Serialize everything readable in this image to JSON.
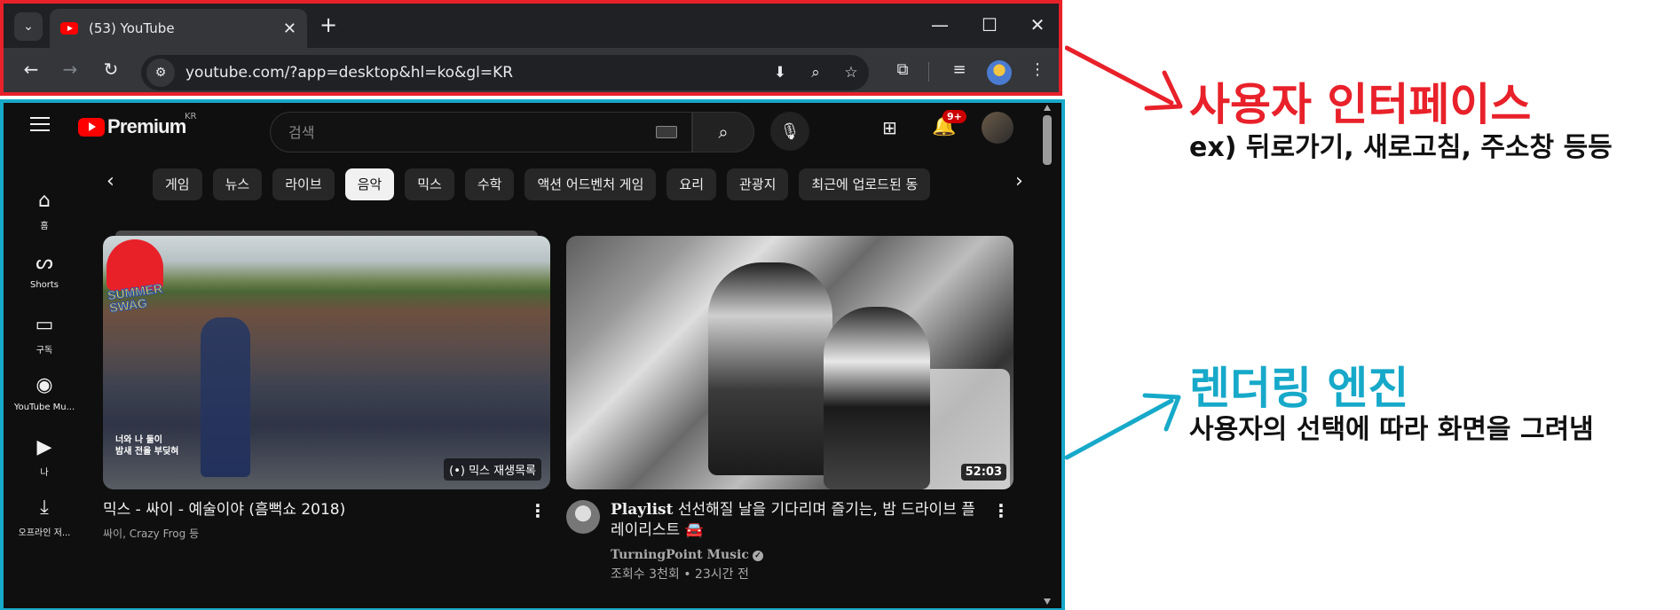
{
  "browser": {
    "tab_title": "(53) YouTube",
    "url": "youtube.com/?app=desktop&hl=ko&gl=KR",
    "accent_color": "#e8212a"
  },
  "youtube": {
    "brand": "Premium",
    "country": "KR",
    "search_placeholder": "검색",
    "notification_count": "9+",
    "sidebar": [
      {
        "label": "홈",
        "icon": "home-icon"
      },
      {
        "label": "Shorts",
        "icon": "shorts-icon"
      },
      {
        "label": "구독",
        "icon": "subscriptions-icon"
      },
      {
        "label": "YouTube Mu...",
        "icon": "youtube-music-icon"
      },
      {
        "label": "나",
        "icon": "you-icon"
      },
      {
        "label": "오프라인 저...",
        "icon": "download-icon"
      }
    ],
    "chips": [
      "게임",
      "뉴스",
      "라이브",
      "음악",
      "믹스",
      "수학",
      "액션 어드벤처 게임",
      "요리",
      "관광지",
      "최근에 업로드된 동"
    ],
    "active_chip": "음악",
    "videos": [
      {
        "title": "믹스 - 싸이 - 예술이야 (흠뻑쇼 2018)",
        "subtitle": "싸이, Crazy Frog 등",
        "overlay": "(•) 믹스 재생목록",
        "thumb_text_1": "SUMMER",
        "thumb_text_2": "SWAG",
        "thumb_caption_1": "너와 나 둘이",
        "thumb_caption_2": "밤새 전율 부딪혀"
      },
      {
        "title_prefix": "Playlist",
        "title": "선선해질 날을 기다리며 즐기는, 밤 드라이브 플레이리스트 🚘",
        "channel": "TurningPoint Music",
        "stats": "조회수 3천회 • 23시간 전",
        "duration": "52:03"
      }
    ]
  },
  "annotations": {
    "ui_title": "사용자 인터페이스",
    "ui_sub": "ex) 뒤로가기, 새로고침, 주소창 등등",
    "ui_color": "#e8212a",
    "engine_title": "렌더링 엔진",
    "engine_sub": "사용자의 선택에 따라 화면을 그려냄",
    "engine_color": "#17a9c9"
  }
}
